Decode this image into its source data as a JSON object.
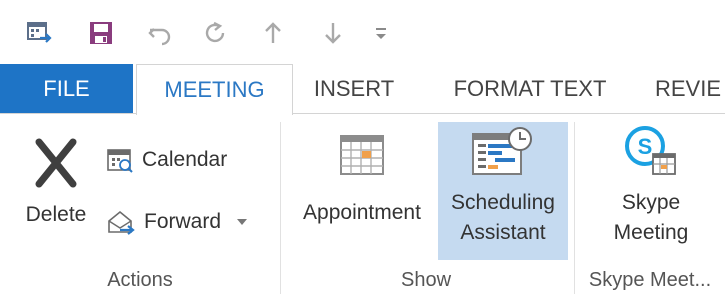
{
  "quick_access": {
    "icons": [
      "calendar-window-icon",
      "save-icon",
      "undo-icon",
      "redo-icon",
      "previous-item-icon",
      "next-item-icon",
      "customize-dropdown-icon"
    ]
  },
  "tabs": [
    {
      "label": "FILE"
    },
    {
      "label": "MEETING"
    },
    {
      "label": "INSERT"
    },
    {
      "label": "FORMAT TEXT"
    },
    {
      "label": "REVIE"
    }
  ],
  "ribbon": {
    "actions": {
      "delete_label": "Delete",
      "calendar_label": "Calendar",
      "forward_label": "Forward",
      "group_label": "Actions"
    },
    "show": {
      "appointment_label": "Appointment",
      "scheduling_line1": "Scheduling",
      "scheduling_line2": "Assistant",
      "group_label": "Show"
    },
    "skype": {
      "line1": "Skype",
      "line2": "Meeting",
      "group_label": "Skype Meet..."
    }
  },
  "colors": {
    "file_tab": "#1e74c6",
    "active_tab_text": "#2b78c4",
    "selected_button": "#c5daf0",
    "accent_orange": "#f0a04b",
    "save_purple": "#8a3c7e"
  }
}
